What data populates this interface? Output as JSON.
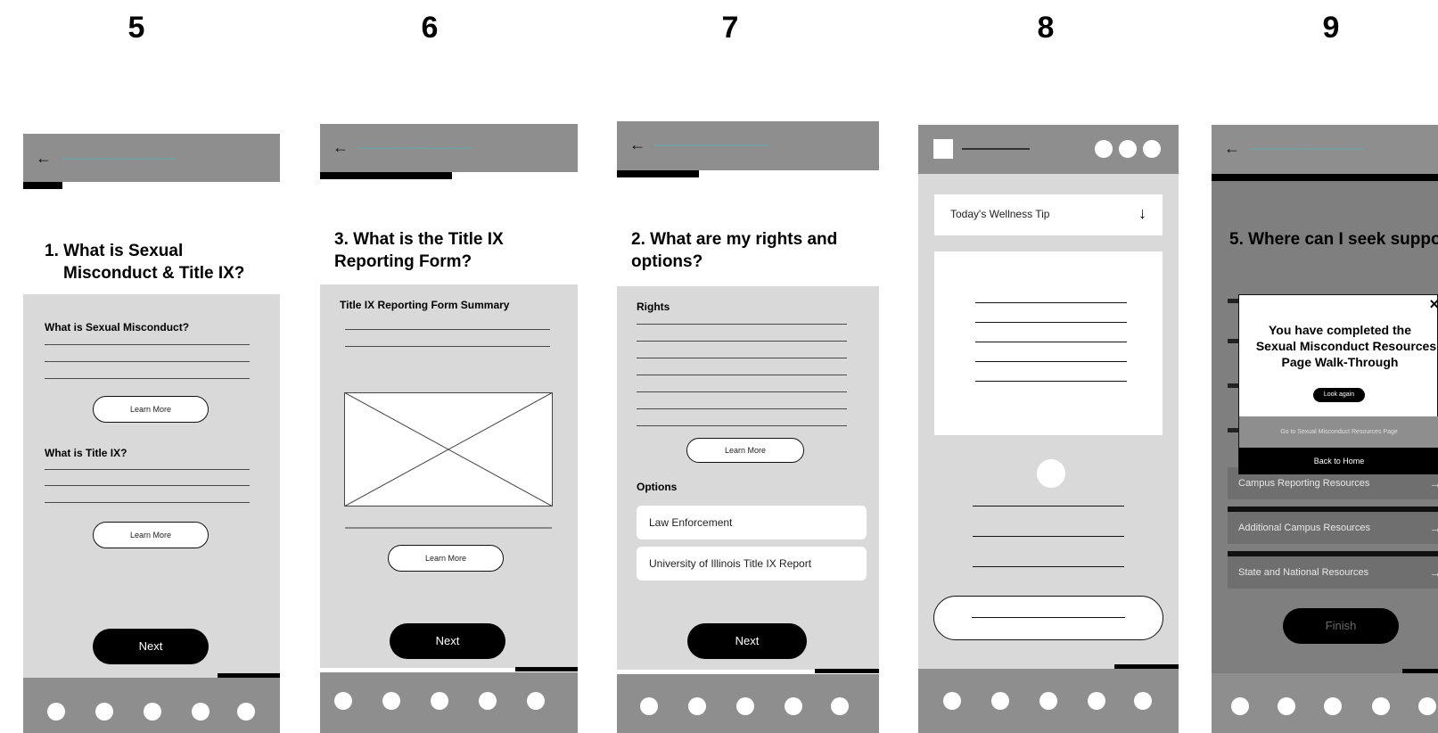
{
  "screen_numbers": [
    "5",
    "6",
    "7",
    "8",
    "9"
  ],
  "screen5": {
    "title_line1": "1. What is Sexual",
    "title_line2": "Misconduct & Title IX?",
    "sub1": "What is Sexual Misconduct?",
    "learn_more_1": "Learn More",
    "sub2": "What is Title IX?",
    "learn_more_2": "Learn More",
    "next": "Next"
  },
  "screen6": {
    "title_line1": "3. What is the Title IX",
    "title_line2": "Reporting Form?",
    "summary": "Title IX Reporting Form  Summary",
    "learn_more": "Learn More",
    "next": "Next"
  },
  "screen7": {
    "title_line1": "2. What are my rights and",
    "title_line2": "options?",
    "rights": "Rights",
    "learn_more": "Learn More",
    "options": "Options",
    "option1": "Law Enforcement",
    "option2": "University of Illinois Title IX Report",
    "next": "Next"
  },
  "screen8": {
    "tip": "Today's Wellness Tip",
    "tip_arrow": "↓"
  },
  "screen9": {
    "title": "5. Where can I seek suppor",
    "modal_line1": "You have completed the",
    "modal_line2": "Sexual Misconduct Resources",
    "modal_line3": "Page Walk-Through",
    "look_again": "Look again",
    "go_to": "Go to Sexual Misconduct Resources Page",
    "back_home": "Back to Home",
    "close": "×",
    "res1": "Campus Reporting Resources",
    "res2": "Additional Campus Resources",
    "res3": "State and National Resources",
    "finish": "Finish"
  },
  "colors": {
    "bar": "#8e8e8e",
    "panel": "#d9d9d9",
    "accent": "#3cc6cc",
    "black": "#000000"
  },
  "icons": [
    "back-arrow-icon",
    "down-arrow-icon",
    "close-icon",
    "right-arrow-icon"
  ]
}
